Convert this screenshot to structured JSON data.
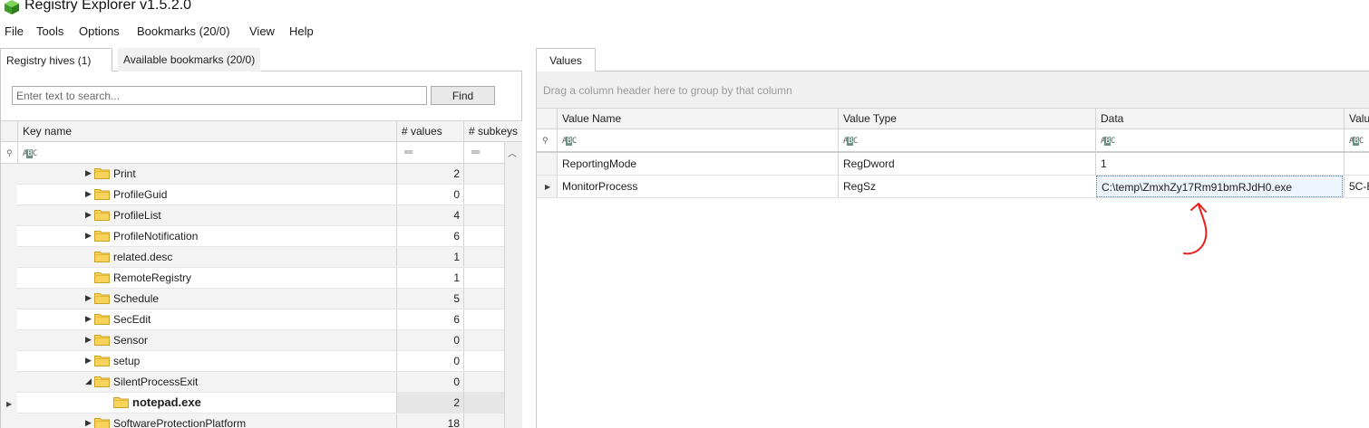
{
  "window": {
    "title": "Registry Explorer v1.5.2.0",
    "icon": "cube-icon"
  },
  "menu": [
    "File",
    "Tools",
    "Options",
    "Bookmarks (20/0)",
    "View",
    "Help"
  ],
  "left_tabs": [
    "Registry hives (1)",
    "Available bookmarks (20/0)"
  ],
  "search": {
    "placeholder": "Enter text to search...",
    "button": "Find"
  },
  "tree_columns": [
    "Key name",
    "# values",
    "# subkeys"
  ],
  "tree_rows": [
    {
      "name": "Print",
      "values": "2",
      "expandable": true
    },
    {
      "name": "ProfileGuid",
      "values": "0",
      "expandable": true
    },
    {
      "name": "ProfileList",
      "values": "4",
      "expandable": true
    },
    {
      "name": "ProfileNotification",
      "values": "6",
      "expandable": true
    },
    {
      "name": "related.desc",
      "values": "1",
      "expandable": false
    },
    {
      "name": "RemoteRegistry",
      "values": "1",
      "expandable": false
    },
    {
      "name": "Schedule",
      "values": "5",
      "expandable": true
    },
    {
      "name": "SecEdit",
      "values": "6",
      "expandable": true
    },
    {
      "name": "Sensor",
      "values": "0",
      "expandable": true
    },
    {
      "name": "setup",
      "values": "0",
      "expandable": true
    },
    {
      "name": "SilentProcessExit",
      "values": "0",
      "expanded": true
    },
    {
      "name": "notepad.exe",
      "values": "2",
      "selected": true
    },
    {
      "name": "SoftwareProtectionPlatform",
      "values": "18",
      "expandable": true
    }
  ],
  "right_tabs": [
    "Values"
  ],
  "group_hint": "Drag a column header here to group by that column",
  "value_columns": [
    "Value Name",
    "Value Type",
    "Data",
    "Valu"
  ],
  "value_rows": [
    {
      "name": "ReportingMode",
      "type": "RegDword",
      "data": "1",
      "extra": ""
    },
    {
      "name": "MonitorProcess",
      "type": "RegSz",
      "data": "C:\\temp\\ZmxhZy17Rm91bmRJdH0.exe",
      "extra": "5C-E"
    }
  ],
  "colors": {
    "annotation": "#e8201c",
    "folder": "#f5c842",
    "selected_bg": "#e6e6e6"
  }
}
